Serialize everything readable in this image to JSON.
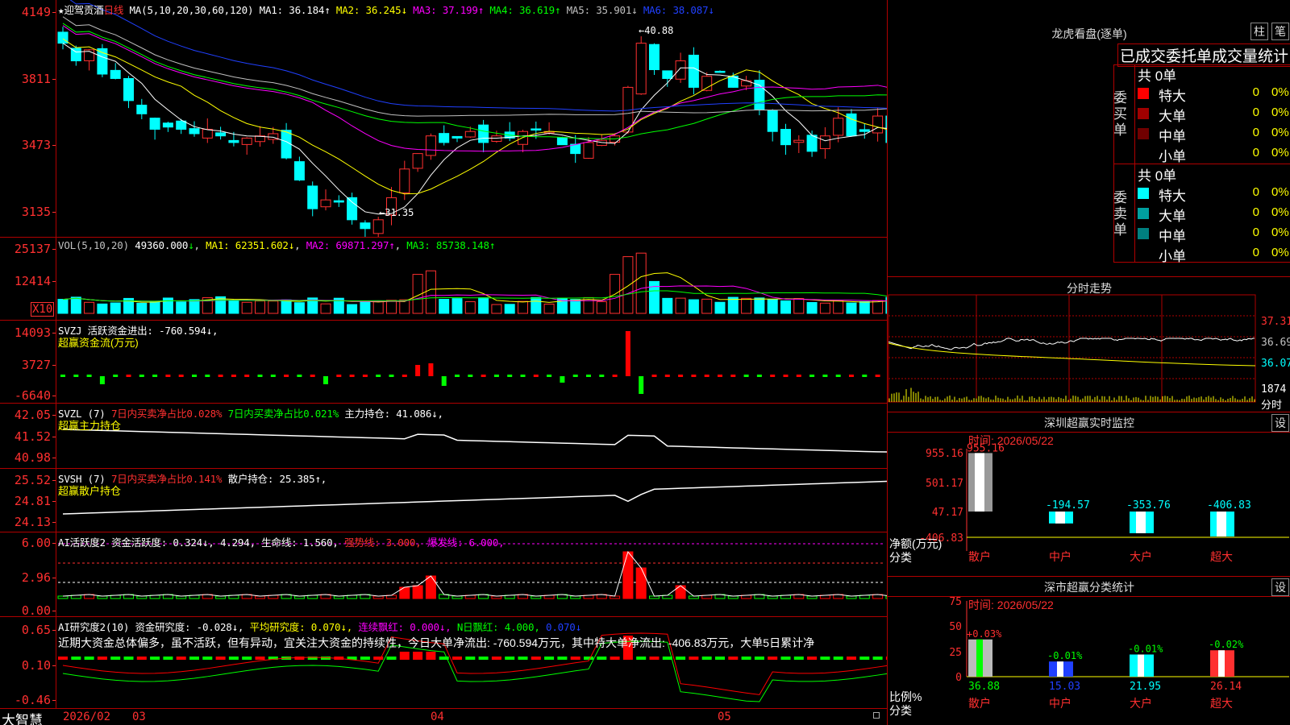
{
  "app": {
    "brand": "大智慧"
  },
  "kline": {
    "star": "★",
    "name": "迎驾贡酒",
    "period": "日线",
    "ma_title": "MA(5,10,20,30,60,120)",
    "ma": [
      {
        "label": "MA1:",
        "value": "36.184",
        "arrow": "↑",
        "color": "#ffffff"
      },
      {
        "label": "MA2:",
        "value": "36.245",
        "arrow": "↓",
        "color": "#ffff00"
      },
      {
        "label": "MA3:",
        "value": "37.199",
        "arrow": "↑",
        "color": "#ff00ff"
      },
      {
        "label": "MA4:",
        "value": "36.619",
        "arrow": "↑",
        "color": "#00ff00"
      },
      {
        "label": "MA5:",
        "value": "35.901",
        "arrow": "↓",
        "color": "#c0c0c0"
      },
      {
        "label": "MA6:",
        "value": "38.087",
        "arrow": "↓",
        "color": "#2040ff"
      }
    ],
    "y_ticks": [
      "4149",
      "3811",
      "3473",
      "3135"
    ],
    "high_label": "40.88",
    "low_label": "31.35"
  },
  "vol": {
    "title": "VOL(5,10,20)",
    "value": "49360.000",
    "arrow": "↓",
    "ma1": "MA1: 62351.602↓",
    "ma2": "MA2: 69871.297↑",
    "ma3": "MA3: 85738.148↑",
    "y_ticks": [
      "25137",
      "12414"
    ],
    "unit": "X10"
  },
  "svzj": {
    "title": "SVZJ  活跃资金进出: -760.594↓,",
    "subtitle": "超赢资金流(万元)",
    "y_ticks": [
      "14093",
      "3727",
      "-6640"
    ]
  },
  "svzl": {
    "title_a": "SVZL (7)",
    "title_b": "7日内买卖净占比0.028%",
    "title_c": "7日内买卖净占比0.021%",
    "title_d": "主力持仓: 41.086↓,",
    "subtitle": "超赢主力持仓",
    "y_ticks": [
      "42.05",
      "41.52",
      "40.98"
    ]
  },
  "svsh": {
    "title_a": "SVSH (7)",
    "title_b": "7日内买卖净占比0.141%",
    "title_c": "散户持仓: 25.385↑,",
    "subtitle": "超赢散户持仓",
    "y_ticks": [
      "25.52",
      "24.81",
      "24.13"
    ]
  },
  "ai_active": {
    "title_a": "AI活跃度2 资金活跃度: 0.324↓, 4.294, 生命线: 1.560,",
    "title_b": "强势线: 3.000,",
    "title_c": "爆发线: 6.000,",
    "y_ticks": [
      "6.00",
      "2.96",
      "0.00"
    ]
  },
  "ai_research": {
    "title_a": "AI研究度2(10) 资金研究度: -0.028↓,",
    "title_b": "平均研究度: 0.070↓,",
    "title_c": "连续飘红: 0.000↓,",
    "title_d": "N日飘红: 4.000,",
    "title_e": "0.070↓",
    "comment": "近期大资金总体偏多，虽不活跃，但有异动，宜关注大资金的持续性，今日大单净流出: -760.594万元，其中特大单净流出: -406.83万元，大单5日累计净",
    "y_ticks": [
      "0.65",
      "0.10",
      "-0.46"
    ]
  },
  "dates": {
    "d1": "2026/02",
    "d2": "03",
    "d3": "04",
    "d4": "05"
  },
  "dragon": {
    "title": "龙虎看盘(逐单)",
    "btn1": "柱",
    "btn2": "笔",
    "headline": "已成交委托单成交量统计",
    "buy_label": "委买单",
    "sell_label": "委卖单",
    "buy_total": "共 0单",
    "sell_total": "共 0单",
    "buy_rows": [
      {
        "label": "特大",
        "v1": "0",
        "v2": "0%",
        "color": "#ff0000"
      },
      {
        "label": "大单",
        "v1": "0",
        "v2": "0%",
        "color": "#a00000"
      },
      {
        "label": "中单",
        "v1": "0",
        "v2": "0%",
        "color": "#700000"
      },
      {
        "label": "小单",
        "v1": "0",
        "v2": "0%",
        "color": "#000000"
      }
    ],
    "sell_rows": [
      {
        "label": "特大",
        "v1": "0",
        "v2": "0%",
        "color": "#00ffff"
      },
      {
        "label": "大单",
        "v1": "0",
        "v2": "0%",
        "color": "#00a0a0"
      },
      {
        "label": "中单",
        "v1": "0",
        "v2": "0%",
        "color": "#008080"
      },
      {
        "label": "小单",
        "v1": "0",
        "v2": "0%",
        "color": "#000000"
      }
    ]
  },
  "intraday": {
    "title": "分时走势",
    "y_ticks": [
      "37.31",
      "36.69",
      "36.07"
    ],
    "vol_label": "1874",
    "period_label": "分时"
  },
  "sz_monitor": {
    "title": "深圳超赢实时监控",
    "btn": "设",
    "time": "时间: 2026/05/22",
    "y_ticks": [
      "955.16",
      "501.17",
      "47.17",
      "-406.83"
    ],
    "ylabel": "净额(万元)",
    "xlabel": "分类",
    "cats": [
      "散户",
      "中户",
      "大户",
      "超大"
    ],
    "values": [
      "955.16",
      "-194.57",
      "-353.76",
      "-406.83"
    ]
  },
  "sz_class": {
    "title": "深市超赢分类统计",
    "btn": "设",
    "time": "时间: 2026/05/22",
    "y_ticks": [
      "75",
      "50",
      "25",
      "0"
    ],
    "ylabel": "比例%",
    "xlabel": "分类",
    "cats": [
      "散户",
      "中户",
      "大户",
      "超大"
    ],
    "values": [
      "36.88",
      "15.03",
      "21.95",
      "26.14"
    ],
    "changes": [
      "+0.03%",
      "-0.01%",
      "-0.01%",
      "-0.02%"
    ]
  }
}
